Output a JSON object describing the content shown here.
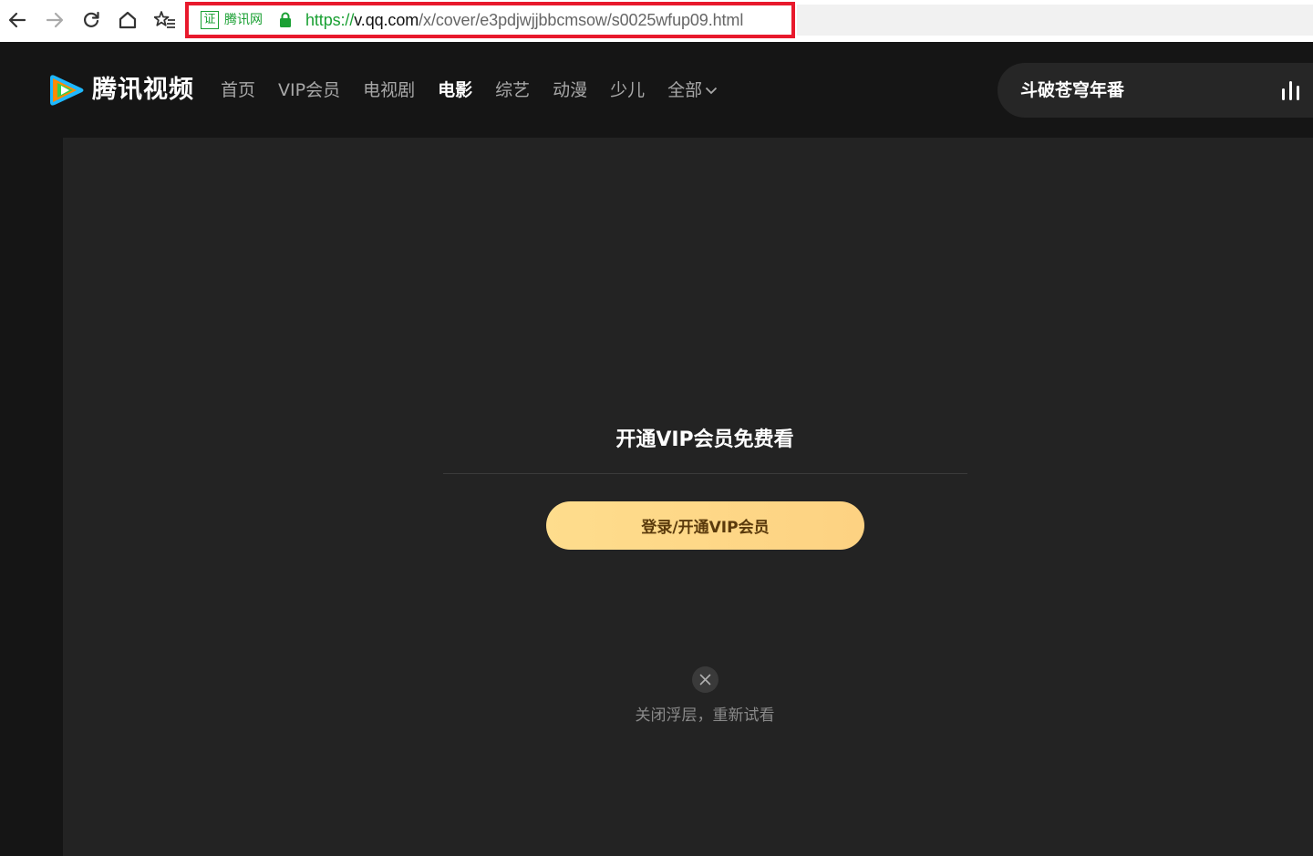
{
  "browser": {
    "back_icon": "arrow-left-icon",
    "forward_icon": "arrow-right-icon",
    "reload_icon": "reload-icon",
    "home_icon": "home-icon",
    "favorites_icon": "star-list-icon",
    "cert_badge": "证",
    "cert_label": "腾讯网",
    "url_scheme": "https://",
    "url_host": "v.qq.com",
    "url_path": "/x/cover/e3pdjwjjbbcmsow/s0025wfup09.html",
    "highlight_color": "#e8192c",
    "secure_color": "#1aa033"
  },
  "header": {
    "logo_text": "腾讯视频",
    "nav": [
      {
        "label": "首页",
        "active": false
      },
      {
        "label": "VIP会员",
        "active": false
      },
      {
        "label": "电视剧",
        "active": false
      },
      {
        "label": "电影",
        "active": true
      },
      {
        "label": "综艺",
        "active": false
      },
      {
        "label": "动漫",
        "active": false
      },
      {
        "label": "少儿",
        "active": false
      },
      {
        "label": "全部",
        "active": false,
        "dropdown": true
      }
    ],
    "search_text": "斗破苍穹年番",
    "hot_icon": "bar-chart-icon"
  },
  "player": {
    "title": "开通VIP会员免费看",
    "button_label": "登录/开通VIP会员",
    "close_icon": "close-icon",
    "close_caption": "关闭浮层，重新试看",
    "button_color": "#fedd8d"
  }
}
